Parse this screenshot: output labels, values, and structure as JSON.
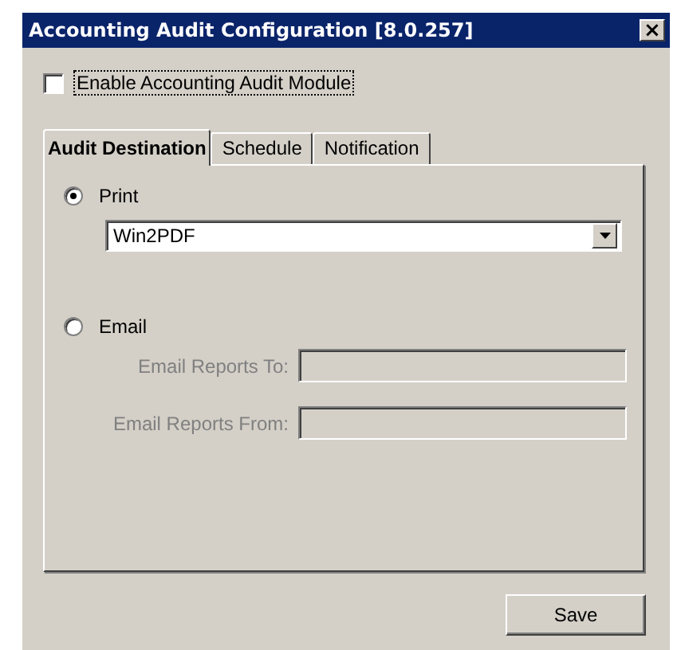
{
  "window": {
    "title": "Accounting Audit Configuration [8.0.257]",
    "close": "×"
  },
  "enable_checkbox": {
    "label": "Enable Accounting Audit Module",
    "checked": false,
    "focused": true
  },
  "tabs": [
    {
      "label": "Audit Destination",
      "selected": true
    },
    {
      "label": "Schedule",
      "selected": false
    },
    {
      "label": "Notification",
      "selected": false
    }
  ],
  "print": {
    "label": "Print",
    "selected": true,
    "printer": "Win2PDF"
  },
  "email": {
    "label": "Email",
    "selected": false,
    "fields": [
      {
        "label": "Email Reports To:",
        "disabled": true
      },
      {
        "label": "Email Reports From:",
        "disabled": true
      }
    ]
  },
  "buttons": [
    {
      "label": "Save"
    }
  ]
}
